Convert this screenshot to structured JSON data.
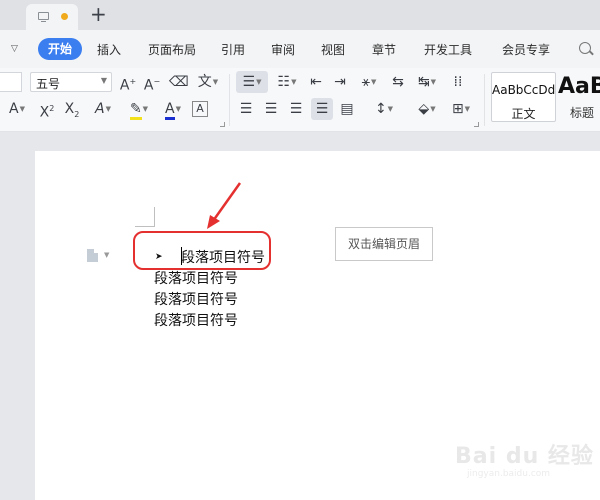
{
  "menubar": {
    "items": [
      "开始",
      "插入",
      "页面布局",
      "引用",
      "审阅",
      "视图",
      "章节",
      "开发工具",
      "会员专享"
    ]
  },
  "ribbon": {
    "font_size": "五号",
    "styles": {
      "normal_sample": "AaBbCcDd",
      "normal_label": "正文",
      "heading_sample": "AaB",
      "heading_label": "标题"
    }
  },
  "document": {
    "header_button": "双击编辑页眉",
    "paragraphs": [
      "段落项目符号",
      "段落项目符号",
      "段落项目符号",
      "段落项目符号"
    ]
  },
  "watermark": {
    "logo": "Bai du 经验",
    "url": "jingyan.baidu.com"
  },
  "colors": {
    "accent": "#3a7ef0",
    "highlight_red": "#e53030",
    "unsaved_dot": "#f0a91b"
  }
}
